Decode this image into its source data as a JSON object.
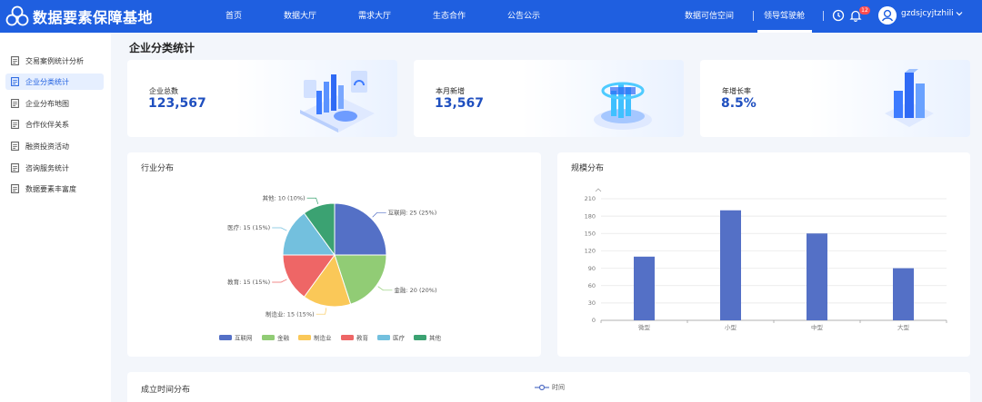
{
  "header": {
    "title": "数据要素保障基地",
    "nav": [
      "首页",
      "数据大厅",
      "需求大厅",
      "生态合作",
      "公告公示"
    ],
    "right_links": [
      "数据可信空间",
      "领导驾驶舱"
    ],
    "active": "领导驾驶舱",
    "notification_count": "12",
    "username": "gzdsjcyjtzhili",
    "colors": {
      "bar": "#1f5fe0",
      "badge": "#ff4d4f"
    }
  },
  "sidebar": {
    "items": [
      {
        "label": "交易案例统计分析",
        "active": false
      },
      {
        "label": "企业分类统计",
        "active": true
      },
      {
        "label": "企业分布地图",
        "active": false
      },
      {
        "label": "合作伙伴关系",
        "active": false
      },
      {
        "label": "融资投资活动",
        "active": false
      },
      {
        "label": "咨询服务统计",
        "active": false
      },
      {
        "label": "数据要素丰富度",
        "active": false
      }
    ]
  },
  "main": {
    "page_title": "企业分类统计",
    "stats": [
      {
        "label": "企业总数",
        "value": "123,567"
      },
      {
        "label": "本月新增",
        "value": "13,567"
      },
      {
        "label": "年增长率",
        "value": "8.5%"
      }
    ],
    "industry_panel": {
      "title": "行业分布"
    },
    "scale_panel": {
      "title": "规模分布"
    },
    "time_panel": {
      "title": "成立时间分布",
      "legend": "时间"
    }
  },
  "chart_data": [
    {
      "type": "pie",
      "title": "行业分布",
      "slices": [
        {
          "name": "互联网",
          "value": 25,
          "label": "互联网: 25 (25%)",
          "color": "#5470c6"
        },
        {
          "name": "金融",
          "value": 20,
          "label": "金融: 20 (20%)",
          "color": "#91cc75"
        },
        {
          "name": "制造业",
          "value": 15,
          "label": "制造业: 15 (15%)",
          "color": "#fac858"
        },
        {
          "name": "教育",
          "value": 15,
          "label": "教育: 15 (15%)",
          "color": "#ee6666"
        },
        {
          "name": "医疗",
          "value": 15,
          "label": "医疗: 15 (15%)",
          "color": "#73c0de"
        },
        {
          "name": "其他",
          "value": 10,
          "label": "其他: 10 (10%)",
          "color": "#3ba272"
        }
      ],
      "legend": "bottom-center"
    },
    {
      "type": "bar",
      "title": "规模分布",
      "categories": [
        "微型",
        "小型",
        "中型",
        "大型"
      ],
      "values": [
        110,
        190,
        150,
        90
      ],
      "yticks": [
        "0",
        "30",
        "60",
        "90",
        "120",
        "150",
        "180",
        "210"
      ],
      "ylim": [
        0,
        210
      ],
      "color": "#5470c6",
      "grid": true
    }
  ]
}
